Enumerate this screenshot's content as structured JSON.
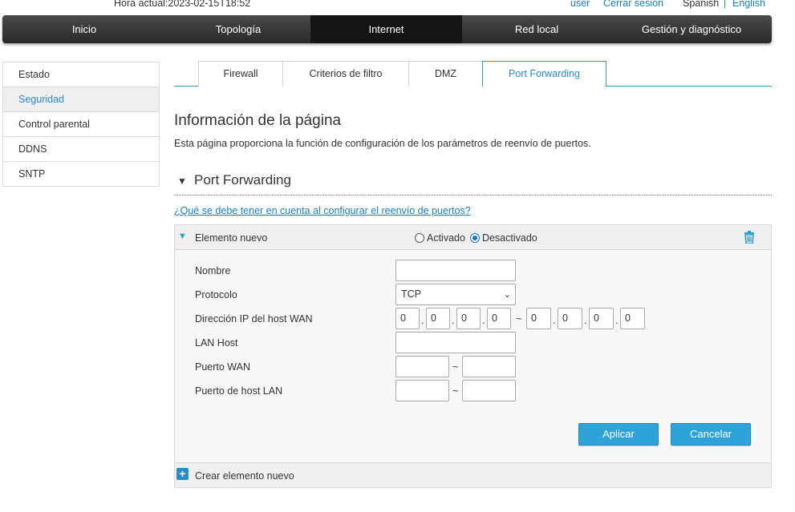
{
  "topbar": {
    "time_label": "Hora actual:2023-02-15T18:52",
    "user_link": "user",
    "logout_link": "Cerrar sesión",
    "lang_es": "Spanish",
    "lang_sep": "|",
    "lang_en": "English"
  },
  "mainnav": {
    "items": [
      {
        "label": "Inicio"
      },
      {
        "label": "Topología"
      },
      {
        "label": "Internet"
      },
      {
        "label": "Red local"
      },
      {
        "label": "Gestión y diagnóstico"
      }
    ],
    "active": "Internet"
  },
  "sidebar": {
    "items": [
      {
        "label": "Estado"
      },
      {
        "label": "Seguridad"
      },
      {
        "label": "Control parental"
      },
      {
        "label": "DDNS"
      },
      {
        "label": "SNTP"
      }
    ],
    "active": "Seguridad"
  },
  "tabs": {
    "items": [
      {
        "label": "Firewall"
      },
      {
        "label": "Criterios de filtro"
      },
      {
        "label": "DMZ"
      },
      {
        "label": "Port Forwarding"
      }
    ],
    "active": "Port Forwarding"
  },
  "page": {
    "title": "Información de la página",
    "description": "Esta página proporciona la función de configuración de los parámetros de reenvío de puertos.",
    "section_title": "Port Forwarding",
    "help_link": "¿Qué se debe tener en cuenta al configurar el reenvío de puertos?"
  },
  "item": {
    "title": "Elemento nuevo",
    "radio_on": "Activado",
    "radio_off": "Desactivado",
    "selected": "Desactivado",
    "labels": {
      "name": "Nombre",
      "protocol": "Protocolo",
      "wan_ip": "Dirección IP del host WAN",
      "lan_host": "LAN Host",
      "wan_port": "Puerto WAN",
      "lan_port": "Puerto de host LAN"
    },
    "values": {
      "name": "",
      "protocol": "TCP",
      "wan_ip_start": [
        "0",
        "0",
        "0",
        "0"
      ],
      "wan_ip_end": [
        "0",
        "0",
        "0",
        "0"
      ],
      "lan_host": "",
      "wan_port_start": "",
      "wan_port_end": "",
      "lan_port_start": "",
      "lan_port_end": ""
    },
    "dot": ".",
    "range_sep": "~",
    "apply": "Aplicar",
    "cancel": "Cancelar"
  },
  "footer": {
    "create_label": "Crear elemento nuevo",
    "plus_glyph": "+"
  },
  "colors": {
    "accent": "#2a9bc7",
    "link": "#1a7fb8",
    "button": "#2ea3d9",
    "nav_bg": "#3a3a3a",
    "nav_active": "#151515"
  },
  "icons": {
    "section_toggle": "triangle-down-icon",
    "item_toggle": "triangle-down-icon",
    "delete": "trash-icon",
    "create": "plus-icon",
    "select": "chevron-down-icon"
  }
}
